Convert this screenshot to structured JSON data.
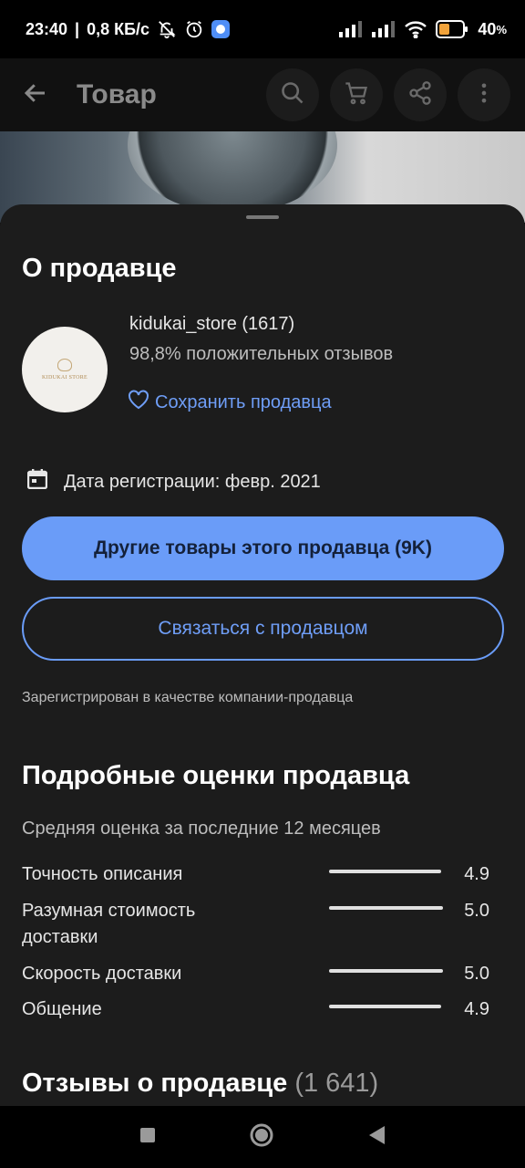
{
  "status_bar": {
    "time": "23:40",
    "speed": "0,8 КБ/с",
    "battery": "40",
    "icons": [
      "mute-icon",
      "alarm-icon",
      "app-notification-icon",
      "signal-icon",
      "signal-icon",
      "wifi-icon",
      "battery-icon"
    ]
  },
  "app_bar": {
    "title": "Товар",
    "icons": [
      "back-arrow-icon",
      "search-icon",
      "cart-icon",
      "share-icon",
      "more-vert-icon"
    ]
  },
  "seller": {
    "section_title": "О продавце",
    "logo_text": "KIDUKAI STORE",
    "name": "kidukai_store (1617)",
    "positive": "98,8% положительных отзывов",
    "save": "Сохранить продавца",
    "registration": "Дата регистрации: февр. 2021",
    "other_products": "Другие товары этого продавца (9K)",
    "contact": "Связаться с продавцом",
    "company_note": "Зарегистрирован в качестве компании-продавца"
  },
  "ratings": {
    "title": "Подробные оценки продавца",
    "subtitle": "Средняя оценка за последние 12 месяцев",
    "items": [
      {
        "label": "Точность описания",
        "value": "4.9",
        "fill": 0.98
      },
      {
        "label": "Разумная стоимость доставки",
        "value": "5.0",
        "fill": 1.0
      },
      {
        "label": "Скорость доставки",
        "value": "5.0",
        "fill": 1.0
      },
      {
        "label": "Общение",
        "value": "4.9",
        "fill": 0.98
      }
    ]
  },
  "reviews": {
    "title": "Отзывы о продавце",
    "count": "(1 641)"
  },
  "colors": {
    "accent": "#6a9cf8",
    "background": "#1c1c1c"
  }
}
